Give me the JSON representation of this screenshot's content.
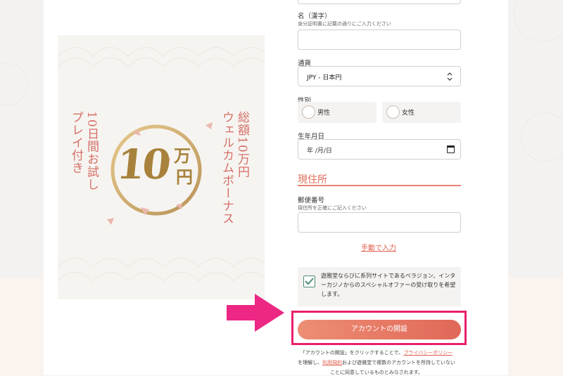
{
  "promo": {
    "line1": "総額10万円",
    "line2": "ウェルカムボーナス",
    "line3": "10日間お試し",
    "line4": "プレイ付き",
    "badge_number": "10",
    "badge_unit_top": "万",
    "badge_unit_bottom": "円"
  },
  "form": {
    "first_name": {
      "label": "名（漢字）",
      "hint": "身分証明書に記載の通りにご入力ください",
      "value": ""
    },
    "currency": {
      "label": "通貨",
      "value": "JPY - 日本円"
    },
    "gender": {
      "label": "性別",
      "options": [
        "男性",
        "女性"
      ]
    },
    "birthdate": {
      "label": "生年月日",
      "placeholder": "年 /月/日"
    },
    "address_section_title": "現住所",
    "postal_code": {
      "label": "郵便番号",
      "hint": "現住所を正確にご記入ください",
      "value": ""
    },
    "manual_entry_link": "手動で入力",
    "consent": {
      "checked": true,
      "text": "遊雅堂ならびに系列サイトであるベラジョン、インターカジノからのスペシャルオファーの受け取りを希望します。"
    },
    "submit_label": "アカウントの開設",
    "legal": {
      "part1": "「アカウントの開設」をクリックすることで、",
      "privacy_link": "プライバシーポリシー",
      "part2": "を理解し、",
      "terms_link": "利用規約",
      "part3": "および遊雅堂で複数のアカウントを所持していない",
      "part4": "ことに同意しているものとみなされます。"
    }
  },
  "colors": {
    "accent": "#e16b58",
    "highlight": "#e8206c",
    "check": "#4d8d79"
  }
}
